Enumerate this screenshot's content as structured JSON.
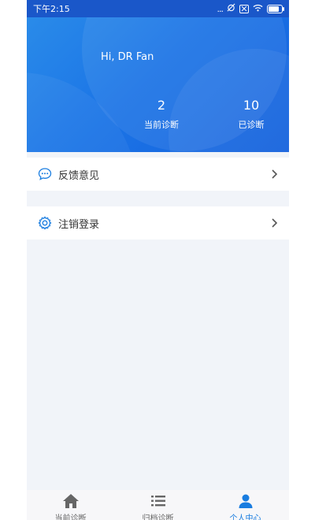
{
  "status_bar": {
    "time": "下午2:15",
    "dots": "...",
    "battery_level": 0.8
  },
  "header": {
    "greeting": "Hi, DR Fan",
    "stats": [
      {
        "value": "2",
        "label": "当前诊断"
      },
      {
        "value": "10",
        "label": "已诊断"
      }
    ]
  },
  "menu": [
    {
      "label": "反馈意见",
      "icon": "chat-bubble-icon"
    },
    {
      "label": "注销登录",
      "icon": "gear-icon"
    }
  ],
  "bottom_nav": [
    {
      "label": "当前诊断",
      "icon": "home-icon"
    },
    {
      "label": "归档诊断",
      "icon": "list-icon"
    },
    {
      "label": "个人中心",
      "icon": "person-icon",
      "active": true
    }
  ],
  "colors": {
    "accent": "#1a7de0",
    "header_start": "#2a8be9",
    "header_end": "#1561dd",
    "background": "#f1f4f9"
  }
}
